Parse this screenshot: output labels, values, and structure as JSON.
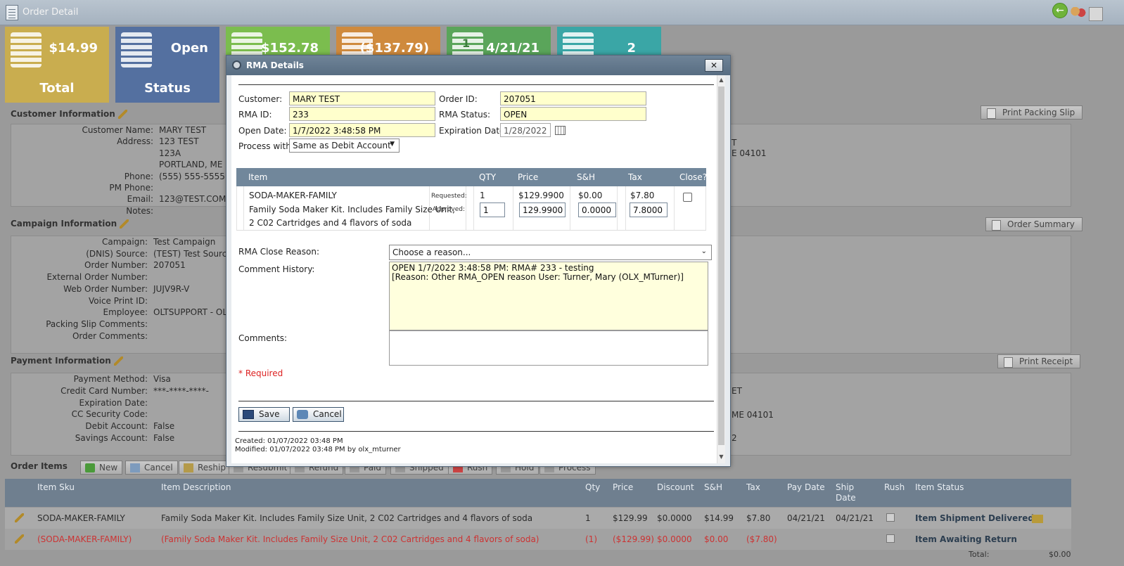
{
  "window": {
    "title": "Order Detail"
  },
  "tiles": [
    {
      "value": "$14.99",
      "label": "Total",
      "icon": "money-stack-icon"
    },
    {
      "value": "Open",
      "label": "Status",
      "icon": "filing-cabinet-icon"
    },
    {
      "value": "$152.78",
      "label": "",
      "icon": "money-stack-icon"
    },
    {
      "value": "($137.79)",
      "label": "",
      "icon": "money-stack-icon"
    },
    {
      "value": "4/21/21",
      "label": "",
      "icon": "calendar-icon",
      "badge": "1"
    },
    {
      "value": "2",
      "label": "",
      "icon": "open-box-icon"
    }
  ],
  "customer": {
    "title": "Customer Information",
    "print_button": "Print Packing Slip",
    "fields": [
      {
        "k": "Customer Name:",
        "v": "MARY TEST"
      },
      {
        "k": "Address:",
        "v": "123 TEST"
      },
      {
        "k": "",
        "v": "123A"
      },
      {
        "k": "",
        "v": "PORTLAND, ME 04"
      },
      {
        "k": "Phone:",
        "v": "(555) 555-5555 \\"
      },
      {
        "k": "PM Phone:",
        "v": ""
      },
      {
        "k": "Email:",
        "v": "123@TEST.COM"
      },
      {
        "k": "Notes:",
        "v": ""
      }
    ],
    "right_fragments": [
      "T",
      "E 04101"
    ]
  },
  "campaign": {
    "title": "Campaign Information",
    "summary_button": "Order Summary",
    "fields": [
      {
        "k": "Campaign:",
        "v": "Test Campaign"
      },
      {
        "k": "(DNIS) Source:",
        "v": "(TEST) Test Source"
      },
      {
        "k": "Order Number:",
        "v": "207051"
      },
      {
        "k": "External Order Number:",
        "v": ""
      },
      {
        "k": "Web Order Number:",
        "v": "JUJV9R-V"
      },
      {
        "k": "Voice Print ID:",
        "v": ""
      },
      {
        "k": "Employee:",
        "v": "OLTSUPPORT - OLT"
      },
      {
        "k": "Packing Slip Comments:",
        "v": ""
      },
      {
        "k": "Order Comments:",
        "v": ""
      }
    ]
  },
  "payment": {
    "title": "Payment Information",
    "receipt_button": "Print Receipt",
    "fields": [
      {
        "k": "Payment Method:",
        "v": "Visa"
      },
      {
        "k": "Credit Card Number:",
        "v": "***-****-****-"
      },
      {
        "k": "Expiration Date:",
        "v": ""
      },
      {
        "k": "CC Security Code:",
        "v": ""
      },
      {
        "k": "Debit Account:",
        "v": "False"
      },
      {
        "k": "Savings Account:",
        "v": "False"
      }
    ],
    "right_fragments": [
      "ET",
      "ME 04101",
      "2"
    ]
  },
  "order_items": {
    "title": "Order Items",
    "buttons": [
      "New",
      "Cancel",
      "Reship",
      "Resubmit",
      "Refund",
      "Paid",
      "Shipped",
      "Rush",
      "Hold",
      "Process"
    ],
    "columns": [
      "Item Sku",
      "Item Description",
      "Qty",
      "Price",
      "Discount",
      "S&H",
      "Tax",
      "Pay Date",
      "Ship Date",
      "Rush",
      "Item Status"
    ],
    "rows": [
      {
        "sku": "SODA-MAKER-FAMILY",
        "desc": "Family Soda Maker Kit. Includes Family Size Unit, 2 C02 Cartridges and 4 flavors of soda",
        "qty": "1",
        "price": "$129.99",
        "discount": "$0.0000",
        "sh": "$14.99",
        "tax": "$7.80",
        "pay": "04/21/21",
        "ship": "04/21/21",
        "status": "Item Shipment Delivered"
      },
      {
        "sku": "(SODA-MAKER-FAMILY)",
        "desc": "(Family Soda Maker Kit. Includes Family Size Unit, 2 C02 Cartridges and 4 flavors of soda)",
        "qty": "(1)",
        "price": "($129.99)",
        "discount": "$0.0000",
        "sh": "$0.00",
        "tax": "($7.80)",
        "pay": "",
        "ship": "",
        "status": "Item Awaiting Return"
      }
    ],
    "total_label": "Total:",
    "total_value": "$0.00"
  },
  "rma": {
    "title": "RMA Details",
    "close_glyph": "✕",
    "customer_label": "Customer:",
    "customer": "MARY TEST",
    "order_id_label": "Order ID:",
    "order_id": "207051",
    "rma_id_label": "RMA ID:",
    "rma_id": "233",
    "rma_status_label": "RMA Status:",
    "rma_status": "OPEN",
    "open_date_label": "Open Date:",
    "open_date": "1/7/2022 3:48:58 PM",
    "exp_date_label": "Expiration Date:",
    "exp_date": "1/28/2022",
    "process_label": "Process with:",
    "process": "Same as Debit Account",
    "item_table": {
      "headers": [
        "Item",
        "QTY",
        "Price",
        "S&H",
        "Tax",
        "Close?"
      ],
      "sku": "SODA-MAKER-FAMILY",
      "desc_line1": "Family Soda Maker Kit. Includes Family Size Unit,",
      "desc_line2": "2 C02 Cartridges and 4 flavors of soda",
      "requested_label": "Requested:",
      "approved_label": "Approved:",
      "req_qty": "1",
      "req_price": "$129.9900",
      "req_sh": "$0.00",
      "req_tax": "$7.80",
      "app_qty": "1",
      "app_price": "129.9900",
      "app_sh": "0.0000",
      "app_tax": "7.8000"
    },
    "close_reason_label": "RMA Close Reason:",
    "close_reason": "Choose a reason...",
    "history_label": "Comment History:",
    "history_line1": "OPEN 1/7/2022 3:48:58 PM: RMA# 233 - testing",
    "history_line2": "[Reason: Other RMA_OPEN reason User: Turner, Mary (OLX_MTurner)]",
    "comments_label": "Comments:",
    "required_text": "* Required",
    "save": "Save",
    "cancel": "Cancel",
    "created": "Created: 01/07/2022 03:48 PM",
    "modified": "Modified: 01/07/2022 03:48 PM by olx_mturner"
  }
}
